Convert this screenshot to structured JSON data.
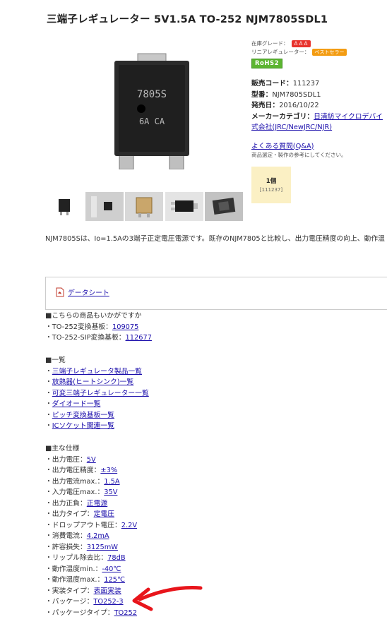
{
  "page": {
    "title": "三端子レギュレーター 5V1.5A TO-252 NJM7805SDL1"
  },
  "chip": {
    "marking1": "7805S",
    "marking2": "6A  CA"
  },
  "rating": {
    "stock_grade_label": "在庫グレード：",
    "stock_grade_badge": "ＡＡＡ",
    "category_label": "リニアレギュレーター：",
    "category_badge": "ベストセラー",
    "rohs": "RoHS2"
  },
  "details": {
    "code_label": "販売コード：",
    "code_value": "111237",
    "model_label": "型番：",
    "model_value": "NJM7805SDL1",
    "date_label": "発売日：",
    "date_value": "2016/10/22",
    "maker_label": "メーカーカテゴリ：",
    "maker_value_line1": "日清紡マイクロデバイ",
    "maker_value_line2": "式会社(JRC/NewJRC/NJR)",
    "faq_link": "よくある質問(Q&A)",
    "faq_note": "商品選定・製作の参考にしてください。"
  },
  "quantity": {
    "label": "1個",
    "code": "[111237]"
  },
  "description": "NJM7805Sは、Io=1.5Aの3端子正定電圧電源です。既存のNJM7805と比較し、出力電圧精度の向上、動作温",
  "datasheet": {
    "label": "データシート"
  },
  "related": {
    "heading": "■こちらの商品もいかがですか",
    "items": [
      {
        "prefix": "・TO-252変換基板：",
        "link": "109075"
      },
      {
        "prefix": "・TO-252-SIP変換基板：",
        "link": "112677"
      }
    ]
  },
  "lists": {
    "heading": "■一覧",
    "items": [
      "三端子レギュレータ製品一覧",
      "放熱器(ヒートシンク)一覧",
      "可変三端子レギュレーター一覧",
      "ダイオード一覧",
      "ピッチ変換基板一覧",
      "ICソケット関連一覧"
    ]
  },
  "specs": {
    "heading": "■主な仕様",
    "items": [
      {
        "label": "・出力電圧：",
        "value": "5V"
      },
      {
        "label": "・出力電圧精度：",
        "value": "±3%"
      },
      {
        "label": "・出力電流max.：",
        "value": "1.5A"
      },
      {
        "label": "・入力電圧max.：",
        "value": "35V"
      },
      {
        "label": "・出力正負：",
        "value": "正電源"
      },
      {
        "label": "・出力タイプ：",
        "value": "定電圧"
      },
      {
        "label": "・ドロップアウト電圧：",
        "value": "2.2V"
      },
      {
        "label": "・消費電流：",
        "value": "4.2mA"
      },
      {
        "label": "・許容損失：",
        "value": "3125mW"
      },
      {
        "label": "・リップル除去比：",
        "value": "78dB"
      },
      {
        "label": "・動作温度min.：",
        "value": "-40℃"
      },
      {
        "label": "・動作温度max.：",
        "value": "125℃"
      },
      {
        "label": "・実装タイプ：",
        "value": "表面実装"
      },
      {
        "label": "・パッケージ：",
        "value": "TO252-3"
      },
      {
        "label": "・パッケージタイプ：",
        "value": "TO252"
      }
    ]
  },
  "colors": {
    "link": "#1a0dab",
    "badge_red": "#e8322c",
    "badge_orange": "#f39c12",
    "rohs_green": "#5cb531",
    "annotation_red": "#e8151b",
    "qty_bg": "#fbf0c4"
  }
}
